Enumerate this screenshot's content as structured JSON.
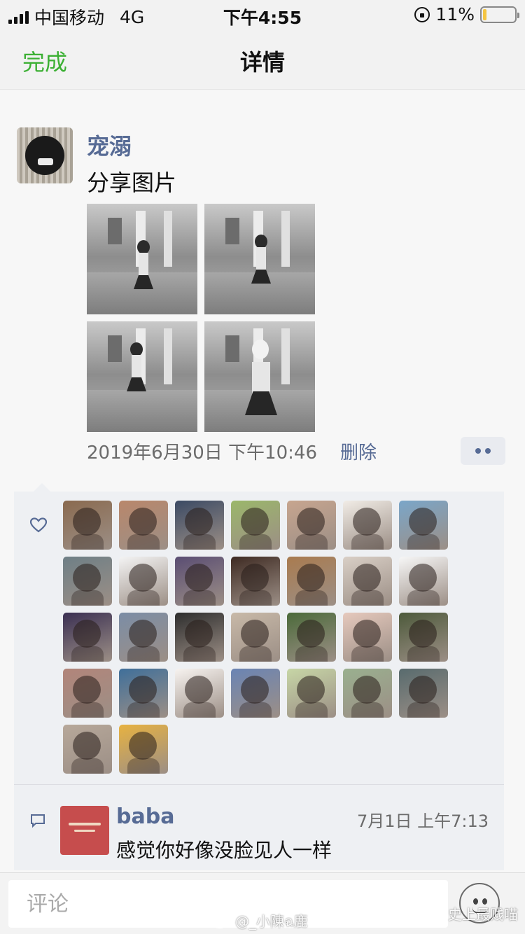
{
  "status_bar": {
    "carrier": "中国移动",
    "network": "4G",
    "time": "下午4:55",
    "battery": "11%",
    "battery_level": 0.11
  },
  "nav": {
    "done_label": "完成",
    "title": "详情"
  },
  "post": {
    "author": "宠溺",
    "text": "分享图片",
    "photo_count": 4,
    "timestamp": "2019年6月30日 下午10:46",
    "delete_label": "删除"
  },
  "likes": {
    "icon": "heart-outline-icon",
    "avatar_colors": [
      "#8a6a4f",
      "#b9876b",
      "#3b4a64",
      "#9bb76a",
      "#c7a58f",
      "#f1ece6",
      "#7aa6c9",
      "#6e7f86",
      "#f4f4f4",
      "#5a4d73",
      "#3e2a22",
      "#a97b4f",
      "#d9cfc6",
      "#f7f7f7",
      "#3a2f52",
      "#7b8da6",
      "#2d2d2d",
      "#c8b9a8",
      "#4b6a3a",
      "#e6c9bd",
      "#4d5a3b",
      "#b2857a",
      "#3f6f9a",
      "#f7f3f0",
      "#6a84b4",
      "#c7d6a6",
      "#9ab08f",
      "#586b6e",
      "#b7a89a",
      "#e7b241"
    ]
  },
  "comment": {
    "icon": "comment-bubble-icon",
    "author": "baba",
    "time": "7月1日 上午7:13",
    "text": "感觉你好像没脸见人一样",
    "avatar_color": "#c64d4d"
  },
  "input_bar": {
    "placeholder": "评论",
    "emoji_icon": "emoji-face-icon"
  },
  "watermarks": {
    "weibo": "@_小陳ฉ鹿",
    "wechat": "史上最贱喵"
  },
  "colors": {
    "accent_green": "#3cb034",
    "link_blue": "#576b95",
    "panel_bg": "#eef0f3"
  }
}
